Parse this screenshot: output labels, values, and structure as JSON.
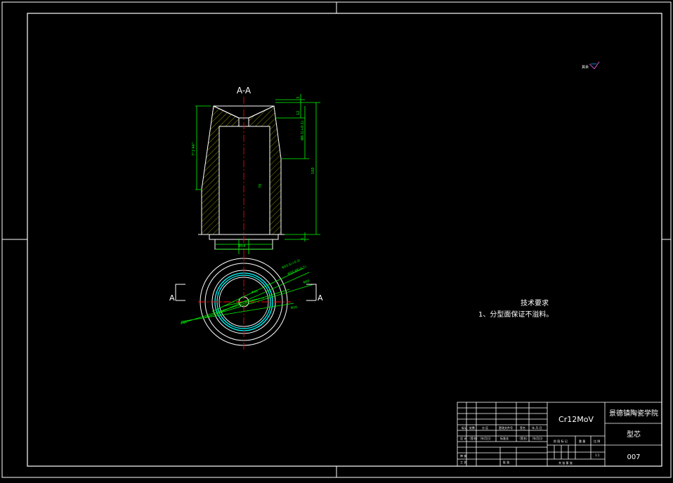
{
  "colors": {
    "background": "#000000",
    "frame": "#ffffff",
    "green_dimension": "#00ff00",
    "red_centerline": "#ff0000",
    "cyan_circle": "#00ffff",
    "yellow_hatch": "#c8c800"
  },
  "drawing": {
    "section_label": "A-A",
    "cut_label_left": "A",
    "cut_label_right": "A",
    "dimensions": {
      "top_small": "3",
      "taper_height": "12",
      "upper_fit": "Φ8.1(+0.1)",
      "total_height": "100",
      "inner_depth": "70",
      "left_outer_taper": "7°1'44\"",
      "bottom_height": "5",
      "bottom_diameter": "Φ54",
      "circle_diameter_1": "Φ55.5(+0.2)",
      "circle_diameter_2": "Φ56.48(-0.1)",
      "circle_diameter_3": "Φ60",
      "circle_diameter_4": "Φ40",
      "circle_diameter_5": "Φ85",
      "circle_diameter_6": "Φ20"
    }
  },
  "roughness_mark": {
    "text": "其余"
  },
  "technical_requirements": {
    "title": "技术要求",
    "item_1": "1、分型面保证不溢料。"
  },
  "title_block": {
    "material": "Cr12MoV",
    "school": "景德镇陶瓷学院",
    "part_name": "型芯",
    "drawing_number": "007",
    "rows": [
      [
        "标记",
        "处数",
        "分 区",
        "更改文件号",
        "签名",
        "年.月.日"
      ],
      [
        "设 计",
        "（签名）",
        "（年月日）",
        "标准化",
        "（签名）",
        "（年月日）"
      ],
      [
        "审 核",
        "",
        "",
        "",
        "",
        ""
      ],
      [
        "工 艺",
        "",
        "批 准",
        "",
        "",
        ""
      ]
    ],
    "stage_labels": [
      "阶 段 标 记",
      "重 量",
      "比 例"
    ],
    "scale": "1:1",
    "sheet_info": "共 张 第 张"
  }
}
